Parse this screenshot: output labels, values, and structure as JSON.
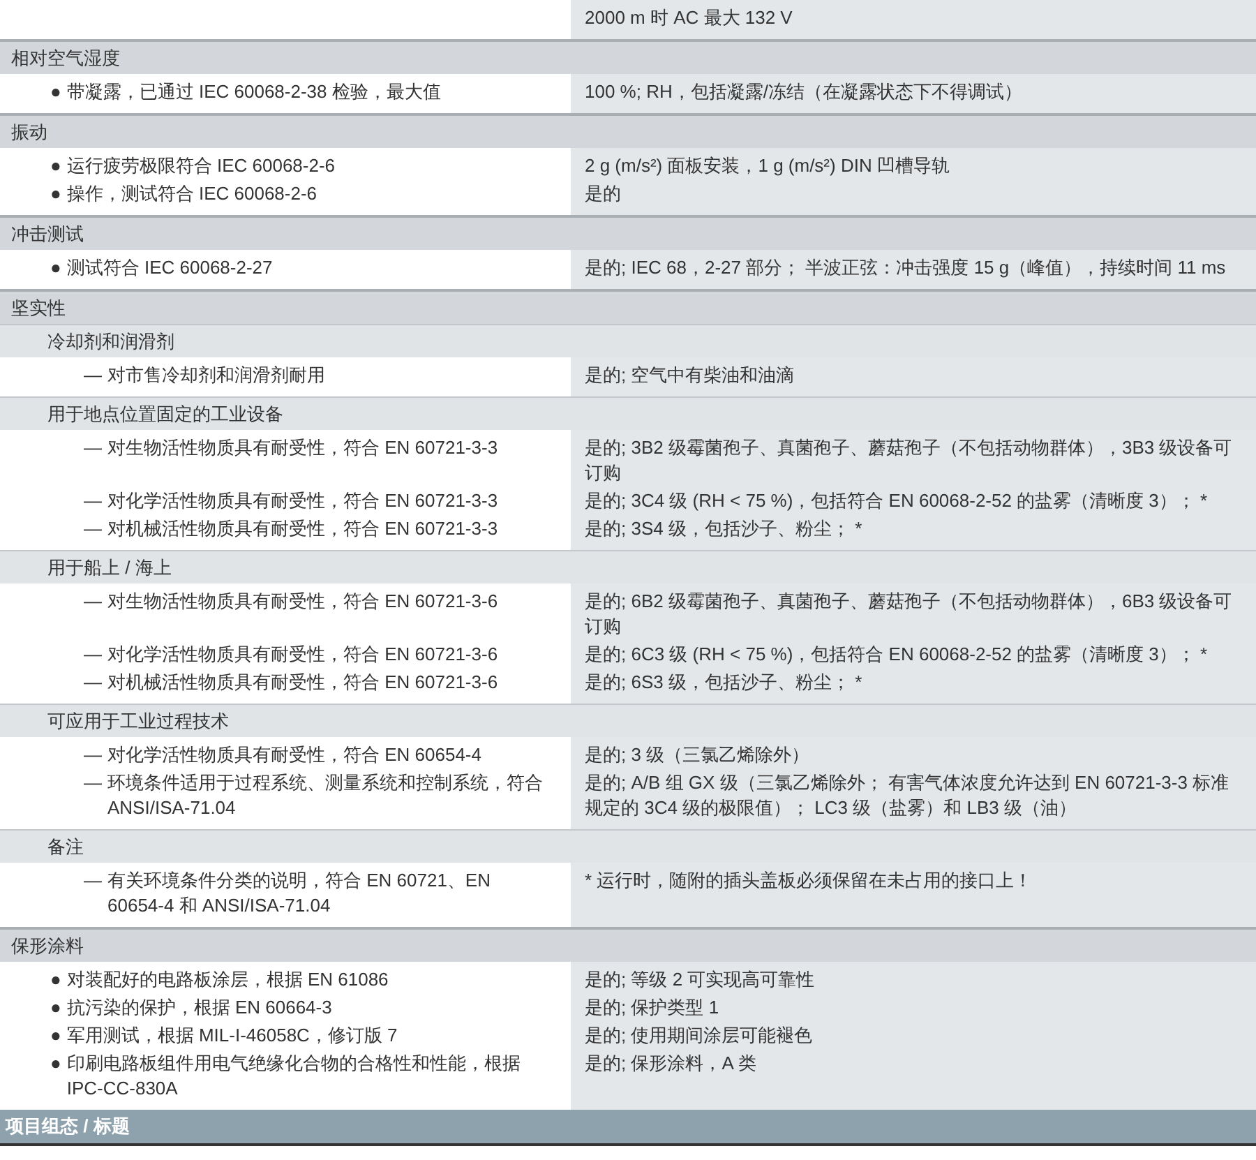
{
  "groups": [
    {
      "rows": [
        {
          "value": "2000 m 时 AC 最大 132 V"
        }
      ]
    },
    {
      "kind": "section",
      "title": "相对空气湿度",
      "rows": [
        {
          "marker": "●",
          "label": "带凝露，已通过 IEC 60068-2-38 检验，最大值",
          "value": "100 %; RH，包括凝露/冻结（在凝露状态下不得调试）"
        }
      ]
    },
    {
      "kind": "section",
      "title": "振动",
      "rows": [
        {
          "marker": "●",
          "label": "运行疲劳极限符合 IEC 60068-2-6",
          "value": "2 g (m/s²) 面板安装，1 g (m/s²) DIN 凹槽导轨"
        },
        {
          "marker": "●",
          "label": "操作，测试符合 IEC 60068-2-6",
          "value": "是的"
        }
      ]
    },
    {
      "kind": "section",
      "title": "冲击测试",
      "rows": [
        {
          "marker": "●",
          "label": "测试符合 IEC 60068-2-27",
          "value": "是的; IEC 68，2-27 部分； 半波正弦：冲击强度 15 g（峰值），持续时间 11 ms"
        }
      ]
    },
    {
      "kind": "section",
      "title": "坚实性"
    },
    {
      "kind": "subsection",
      "title": "冷却剂和润滑剂",
      "rows": [
        {
          "marker": "—",
          "label": "对市售冷却剂和润滑剂耐用",
          "value": "是的; 空气中有柴油和油滴"
        }
      ]
    },
    {
      "kind": "subsection",
      "title": "用于地点位置固定的工业设备",
      "rows": [
        {
          "marker": "—",
          "label": "对生物活性物质具有耐受性，符合 EN 60721-3-3",
          "value": "是的; 3B2 级霉菌孢子、真菌孢子、蘑菇孢子（不包括动物群体），3B3 级设备可订购"
        },
        {
          "marker": "—",
          "label": "对化学活性物质具有耐受性，符合 EN 60721-3-3",
          "value": "是的; 3C4 级 (RH < 75 %)，包括符合 EN 60068-2-52 的盐雾（清晰度 3）； *"
        },
        {
          "marker": "—",
          "label": "对机械活性物质具有耐受性，符合 EN 60721-3-3",
          "value": "是的; 3S4 级，包括沙子、粉尘； *"
        }
      ]
    },
    {
      "kind": "subsection",
      "title": "用于船上 / 海上",
      "rows": [
        {
          "marker": "—",
          "label": "对生物活性物质具有耐受性，符合 EN 60721-3-6",
          "value": "是的; 6B2 级霉菌孢子、真菌孢子、蘑菇孢子（不包括动物群体），6B3 级设备可订购"
        },
        {
          "marker": "—",
          "label": "对化学活性物质具有耐受性，符合 EN 60721-3-6",
          "value": "是的; 6C3 级 (RH < 75 %)，包括符合 EN 60068-2-52 的盐雾（清晰度 3）； *"
        },
        {
          "marker": "—",
          "label": "对机械活性物质具有耐受性，符合 EN 60721-3-6",
          "value": "是的; 6S3 级，包括沙子、粉尘； *"
        }
      ]
    },
    {
      "kind": "subsection",
      "title": "可应用于工业过程技术",
      "rows": [
        {
          "marker": "—",
          "label": "对化学活性物质具有耐受性，符合 EN 60654-4",
          "value": "是的; 3 级（三氯乙烯除外）"
        },
        {
          "marker": "—",
          "label": "环境条件适用于过程系统、测量系统和控制系统，符合 ANSI/ISA-71.04",
          "value": "是的; A/B 组 GX 级（三氯乙烯除外； 有害气体浓度允许达到 EN 60721-3-3 标准规定的 3C4 级的极限值）； LC3 级（盐雾）和 LB3 级（油）"
        }
      ]
    },
    {
      "kind": "subsection",
      "title": "备注",
      "rows": [
        {
          "marker": "—",
          "label": "有关环境条件分类的说明，符合 EN 60721、EN 60654-4 和 ANSI/ISA-71.04",
          "value": "* 运行时，随附的插头盖板必须保留在未占用的接口上！"
        }
      ]
    },
    {
      "kind": "section",
      "title": "保形涂料",
      "rows": [
        {
          "marker": "●",
          "label": "对装配好的电路板涂层，根据 EN 61086",
          "value": "是的; 等级 2 可实现高可靠性"
        },
        {
          "marker": "●",
          "label": "抗污染的保护，根据 EN 60664-3",
          "value": "是的; 保护类型 1"
        },
        {
          "marker": "●",
          "label": "军用测试，根据 MIL-I-46058C，修订版 7",
          "value": "是的; 使用期间涂层可能褪色"
        },
        {
          "marker": "●",
          "label": "印刷电路板组件用电气绝缘化合物的合格性和性能，根据 IPC-CC-830A",
          "value": "是的; 保形涂料，A 类"
        }
      ]
    }
  ],
  "footer": {
    "title": "项目组态 / 标题"
  }
}
